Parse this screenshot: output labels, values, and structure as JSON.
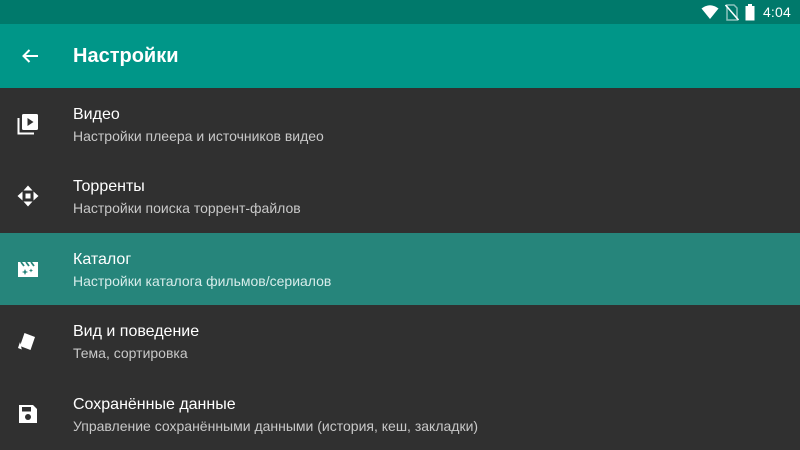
{
  "status_bar": {
    "time": "4:04",
    "icons": [
      "wifi-icon",
      "no-sim-icon",
      "battery-icon"
    ]
  },
  "app_bar": {
    "title": "Настройки",
    "back_icon": "arrow-back-icon"
  },
  "settings": {
    "items": [
      {
        "title": "Видео",
        "subtitle": "Настройки плеера и источников видео",
        "icon": "video-library-icon",
        "selected": false
      },
      {
        "title": "Торренты",
        "subtitle": "Настройки поиска торрент-файлов",
        "icon": "move-arrows-icon",
        "selected": false
      },
      {
        "title": "Каталог",
        "subtitle": "Настройки каталога фильмов/сериалов",
        "icon": "movie-filter-icon",
        "selected": true
      },
      {
        "title": "Вид и поведение",
        "subtitle": "Тема, сортировка",
        "icon": "style-cards-icon",
        "selected": false
      },
      {
        "title": "Сохранённые данные",
        "subtitle": "Управление сохранёнными данными (история, кеш, закладки)",
        "icon": "save-icon",
        "selected": false
      }
    ]
  },
  "colors": {
    "status_bar": "#00796b",
    "app_bar": "#009688",
    "background": "#303030",
    "selected_row": "#26857b",
    "primary_text": "#ffffff",
    "secondary_text": "#c8c8c8"
  }
}
